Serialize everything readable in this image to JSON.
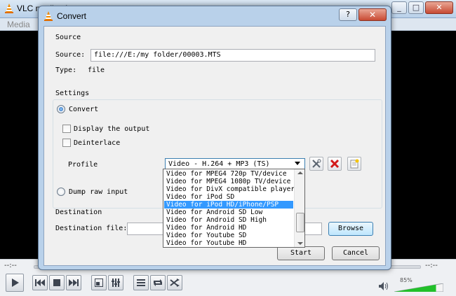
{
  "vlc": {
    "title": "VLC media player",
    "menu_media": "Media",
    "time_elapsed": "--:--",
    "time_total": "--:--",
    "volume_percent": "85%",
    "volume_level": 0.85
  },
  "dialog": {
    "title": "Convert",
    "help_label": "?",
    "close_label": "✕",
    "source": {
      "group_label": "Source",
      "source_label": "Source:",
      "source_value": "file:///E:/my folder/00003.MTS",
      "type_label": "Type:",
      "type_value": "file"
    },
    "settings": {
      "group_label": "Settings",
      "convert_label": "Convert",
      "convert_checked": true,
      "display_output_label": "Display the output",
      "deinterlace_label": "Deinterlace",
      "profile_label": "Profile",
      "profile_value": "Video - H.264 + MP3 (TS)",
      "dump_raw_label": "Dump raw input"
    },
    "profile_options": [
      "Video for MPEG4 720p TV/device",
      "Video for MPEG4 1080p TV/device",
      "Video for DivX compatible player",
      "Video for iPod SD",
      "Video for iPod HD/iPhone/PSP",
      "Video for Android SD Low",
      "Video for Android SD High",
      "Video for Android HD",
      "Video for Youtube SD",
      "Video for Youtube HD"
    ],
    "highlighted_option": 4,
    "destination": {
      "group_label": "Destination",
      "file_label": "Destination file:",
      "file_value": "",
      "browse_label": "Browse"
    },
    "start_label": "Start",
    "cancel_label": "Cancel"
  },
  "colors": {
    "highlight": "#3399ff",
    "dialog_frame": "#b9d1ea",
    "volume_green": "#22c02a"
  }
}
